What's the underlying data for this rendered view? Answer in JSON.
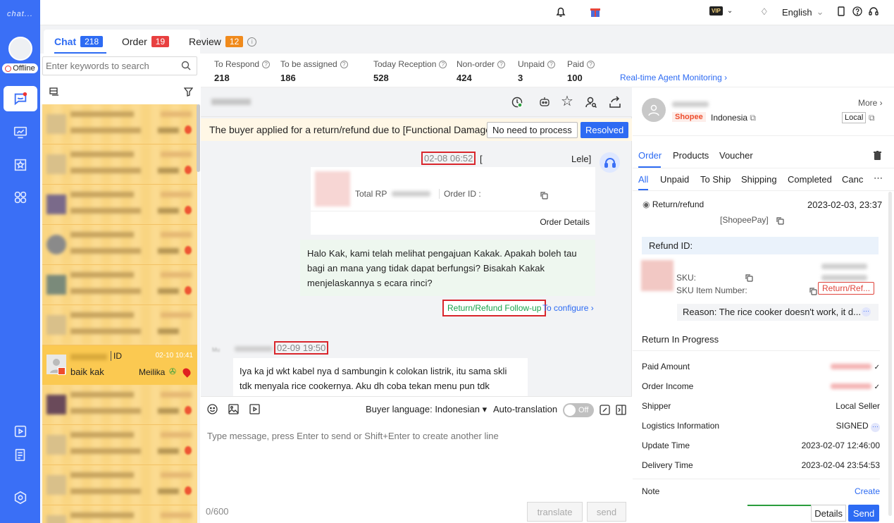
{
  "app": {
    "logo": "chat..."
  },
  "sidebar": {
    "status": "Offline"
  },
  "topbar": {
    "vip": "VIP",
    "language": "English"
  },
  "tabs": [
    {
      "label": "Chat",
      "count": "218"
    },
    {
      "label": "Order",
      "count": "19"
    },
    {
      "label": "Review",
      "count": "12"
    }
  ],
  "search": {
    "placeholder": "Enter keywords to search"
  },
  "selected_chat": {
    "tag": "ID",
    "time": "02-10 10:41",
    "preview": "baik kak",
    "agent": "Meilika"
  },
  "stats": [
    {
      "label": "To Respond",
      "value": "218"
    },
    {
      "label": "To be assigned",
      "value": "186"
    },
    {
      "label": "Today Reception",
      "value": "528"
    },
    {
      "label": "Non-order",
      "value": "424"
    },
    {
      "label": "Unpaid",
      "value": "3"
    },
    {
      "label": "Paid",
      "value": "100"
    }
  ],
  "monitoring_link": "Real-time Agent Monitoring",
  "banner": {
    "text": "The buyer applied for a return/refund due to [Functional Damage...",
    "btn_no_need": "No need to process",
    "btn_resolved": "Resolved"
  },
  "messages": {
    "msg1_time": "02-08 06:52",
    "msg1_bracket": "[",
    "msg1_agent": "Lele]",
    "card_total": "Total RP",
    "card_order_id": "Order ID :",
    "card_details": "Order Details",
    "msg2_text": "Halo Kak, kami telah melihat pengajuan Kakak. Apakah boleh tau bagi an mana yang tidak dapat berfungsi? Bisakah Kakak menjelaskannya s ecara rinci?",
    "followup": "Return/Refund Follow-up",
    "configure": "To configure",
    "msg3_sender": "Mu",
    "msg3_time": "02-09 19:50",
    "msg3_text": "Iya ka jd wkt kabel nya d sambungin k colokan listrik, itu sama skli tdk menyala rice cookernya. Aku dh coba tekan menu pun tdk menyala"
  },
  "composer": {
    "buyer_language_label": "Buyer language:",
    "buyer_language": "Indonesian",
    "auto_translation": "Auto-translation",
    "toggle": "Off",
    "placeholder": "Type message, press Enter to send or Shift+Enter to create another line",
    "counter": "0/600",
    "translate": "translate",
    "send": "send"
  },
  "customer": {
    "more": "More",
    "platform": "Shopee",
    "country": "Indonesia",
    "local": "Local"
  },
  "right_tabs": [
    "Order",
    "Products",
    "Voucher"
  ],
  "order_tabs": [
    "All",
    "Unpaid",
    "To Ship",
    "Shipping",
    "Completed",
    "Canc"
  ],
  "order": {
    "status": "Return/refund",
    "date": "2023-02-03, 23:37",
    "payment": "[ShopeePay]",
    "refund_id_label": "Refund ID:",
    "sku_label": "SKU:",
    "sku_item_label": "SKU Item Number:",
    "return_tag": "Return/Ref...",
    "reason": "Reason: The rice cooker doesn't work, it d...",
    "return_progress": "Return In Progress",
    "paid_amount": "Paid Amount",
    "order_income": "Order Income",
    "shipper_label": "Shipper",
    "shipper_value": "Local Seller",
    "logistics_label": "Logistics Information",
    "logistics_value": "SIGNED",
    "update_label": "Update Time",
    "update_value": "2023-02-07 12:46:00",
    "delivery_label": "Delivery Time",
    "delivery_value": "2023-02-04 23:54:53",
    "note_label": "Note",
    "create": "Create",
    "details_btn": "Details",
    "send_btn": "Send"
  },
  "colors": {
    "brand": "#3a6ff6",
    "resolved": "#2d6bf3",
    "highlight": "#d9262c",
    "chat_item": "#fcd989",
    "followup_green": "#17a34a"
  }
}
